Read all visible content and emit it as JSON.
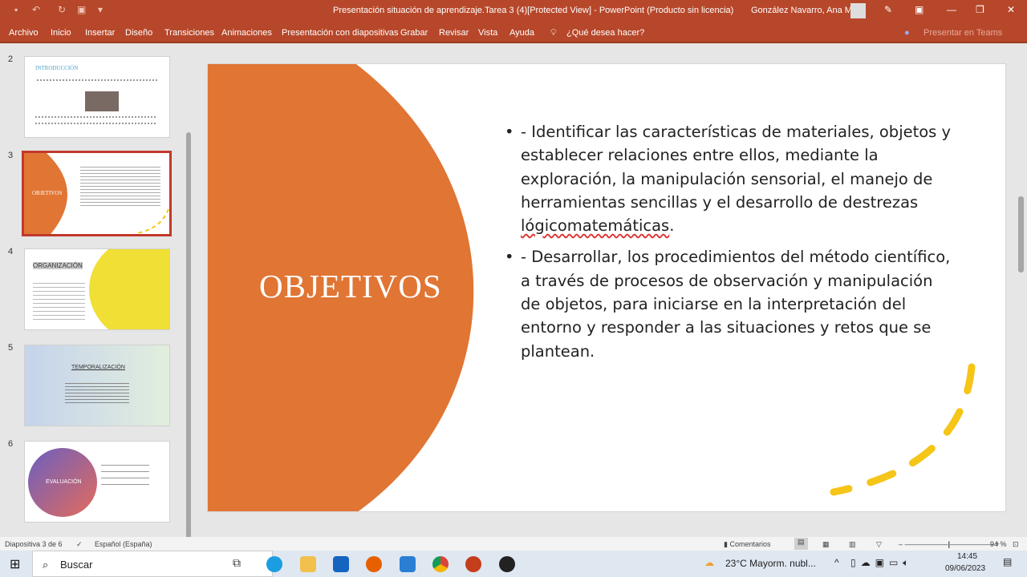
{
  "window": {
    "title": "Presentación situación de aprendizaje.Tarea 3 (4)[Protected View]  -  PowerPoint (Producto sin licencia)",
    "user": "González Navarro, Ana Mª"
  },
  "menu": [
    "Archivo",
    "Inicio",
    "Insertar",
    "Diseño",
    "Transiciones",
    "Animaciones",
    "Presentación con diapositivas",
    "Grabar",
    "Revisar",
    "Vista",
    "Ayuda",
    "¿Qué desea hacer?",
    "Presentar en Teams"
  ],
  "thumbnails": [
    {
      "num": "2",
      "title": "INTRODUCCIÓN"
    },
    {
      "num": "3",
      "title": "OBJETIVOS"
    },
    {
      "num": "4",
      "title": "ORGANIZACIÓN"
    },
    {
      "num": "5",
      "title": "TEMPORALIZACIÓN"
    },
    {
      "num": "6",
      "title": "EVALUACIÓN"
    }
  ],
  "slide": {
    "title": "OBJETIVOS",
    "bullet1_a": "- Identificar las características de materiales, objetos y establecer relaciones entre ellos, mediante la exploración, la manipulación sensorial, el manejo de herramientas sencillas y el desarrollo de destrezas ",
    "bullet1_b": "lógicomatemáticas",
    "bullet1_c": ".",
    "bullet2": "- Desarrollar, los procedimientos del método científico, a través de procesos de observación y manipulación de objetos, para iniciarse en la interpretación del entorno y responder a las situaciones y retos que se plantean."
  },
  "status": {
    "slide": "Diapositiva 3 de 6",
    "language": "Español (España)",
    "comments": "Comentarios",
    "zoom": "94 %"
  },
  "taskbar": {
    "search": "Buscar",
    "weather": "23°C  Mayorm. nubl...",
    "time": "14:45",
    "date": "09/06/2023"
  },
  "colors": {
    "accent": "#b7472a",
    "orange": "#e07534",
    "yellow": "#f5c518"
  }
}
